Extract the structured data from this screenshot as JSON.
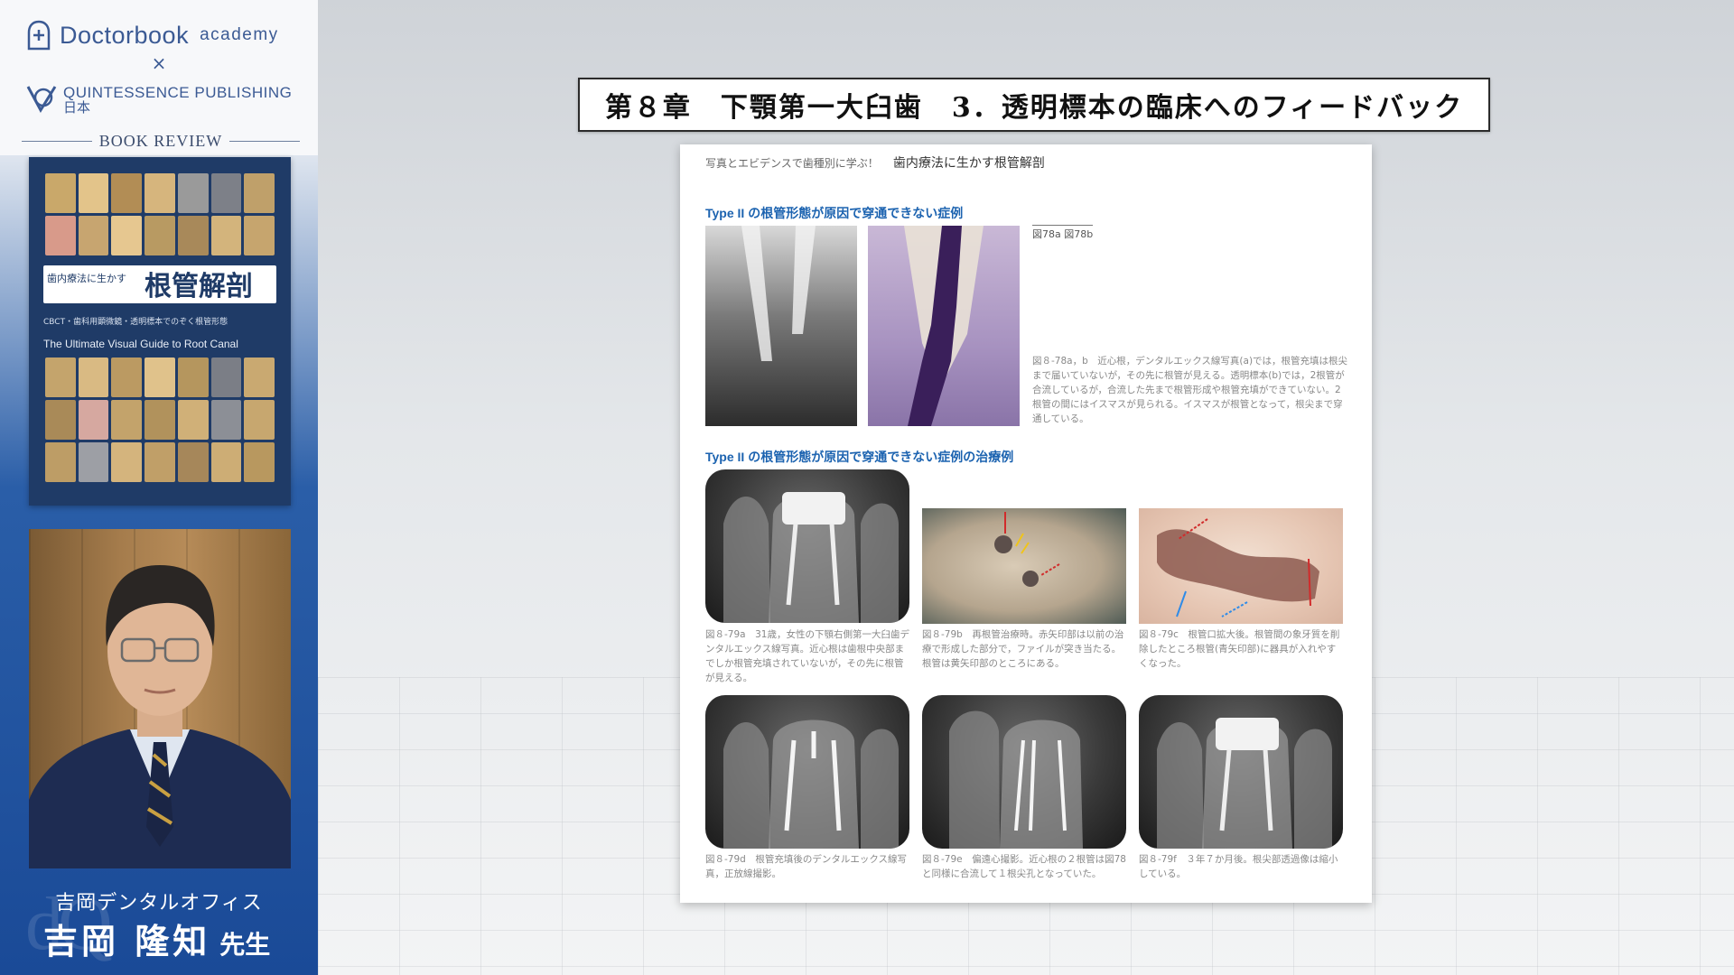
{
  "sidebar": {
    "brand_name": "Doctorbook",
    "brand_sub": "academy",
    "cross": "×",
    "publisher": "QUINTESSENCE PUBLISHING",
    "publisher_jp": "日本",
    "book_review": "BOOK REVIEW",
    "book": {
      "title_small": "歯内療法に生かす",
      "title_big": "根管解剖",
      "subtitle": "CBCT・歯科用顕微鏡・透明標本でのぞく根管形態",
      "english_title": "The Ultimate Visual Guide to Root Canal"
    },
    "presenter": {
      "org": "吉岡デンタルオフィス",
      "name": "吉岡 隆知",
      "honorific": "先生"
    }
  },
  "main": {
    "chapter_title": "第８章　下顎第一大臼歯　3．透明標本の臨床へのフィードバック",
    "page": {
      "header_small": "写真とエビデンスで歯種別に学ぶ！",
      "header_book": "歯内療法に生かす根管解剖",
      "section1_heading": "Type II の根管形態が原因で穿通できない症例",
      "fig_ref": "図78a 図78b",
      "caption_78": "図８-78a，b　近心根，デンタルエックス線写真(a)では，根管充填は根尖まで届いていないが，その先に根管が見える。透明標本(b)では，2根管が合流しているが，合流した先まで根管形成や根管充填ができていない。2根管の間にはイスマスが見られる。イスマスが根管となって，根尖まで穿通している。",
      "section2_heading": "Type II の根管形態が原因で穿通できない症例の治療例",
      "caption_79a": "図８-79a　31歳，女性の下顎右側第一大臼歯デンタルエックス線写真。近心根は歯根中央部までしか根管充填されていないが，その先に根管が見える。",
      "caption_79b": "図８-79b　再根管治療時。赤矢印部は以前の治療で形成した部分で，ファイルが突き当たる。根管は黄矢印部のところにある。",
      "caption_79c": "図８-79c　根管口拡大後。根管間の象牙質を削除したところ根管(青矢印部)に器具が入れやすくなった。",
      "caption_79d": "図８-79d　根管充填後のデンタルエックス線写真，正放線撮影。",
      "caption_79e": "図８-79e　偏遠心撮影。近心根の２根管は図78と同様に合流して１根尖孔となっていた。",
      "caption_79f": "図８-79f　３年７か月後。根尖部透過像は縮小している。"
    }
  },
  "colors": {
    "sidebar_blue": "#1a4a97",
    "brand_blue": "#3b5a94",
    "heading_blue": "#1c63b0"
  }
}
